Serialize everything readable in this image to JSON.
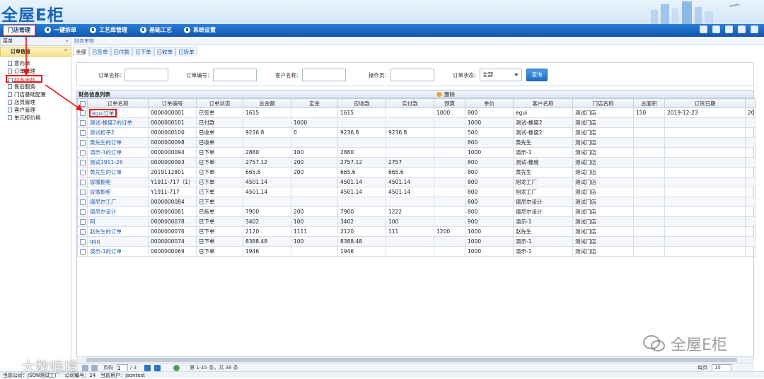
{
  "app": {
    "logo": "全屋E柜"
  },
  "topnav": [
    {
      "label": "门店管理",
      "active": true
    },
    {
      "label": "一键拆单",
      "active": false
    },
    {
      "label": "工艺库管理",
      "active": false
    },
    {
      "label": "基础工艺",
      "active": false
    },
    {
      "label": "系统设置",
      "active": false
    }
  ],
  "sidebar": {
    "header": "菜单",
    "collapse": "«",
    "group": "订单信息",
    "group_arrow": "«",
    "items": [
      "意向单",
      "订单管理",
      "财务审核",
      "售后服务",
      "门店基础配置",
      "店员管理",
      "客户管理",
      "单元柜价格"
    ]
  },
  "breadcrumb": "财务审核",
  "subtabs": [
    "全部",
    "已签单",
    "已付款",
    "已下单",
    "已收单",
    "已拆单"
  ],
  "filter": {
    "order_name_label": "订单名称：",
    "order_no_label": "订单编号：",
    "customer_label": "客户名称：",
    "operator_label": "操作员：",
    "status_label": "订单状态：",
    "status_value": "全部",
    "query_button": "查询"
  },
  "grid": {
    "title": "财务信息列表",
    "delete_label": "删除",
    "columns": [
      "订单名称",
      "订单编号",
      "订单状态",
      "总金额",
      "定金",
      "应收款",
      "实付款",
      "预算",
      "单价",
      "客户名称",
      "门店名称",
      "总面积",
      "订货日期",
      ""
    ],
    "rows": [
      [
        "egui订单",
        "0000000001",
        "已签单",
        "1615",
        "",
        "1615",
        "",
        "1000",
        "800",
        "egui",
        "测试门店",
        "150",
        "2019-12-23",
        "20"
      ],
      [
        "测试-橡度2的订单",
        "0000000101",
        "已付款",
        "",
        "1000",
        "",
        "",
        "",
        "1000",
        "测试-橡度2",
        "测试门店",
        "",
        "",
        ""
      ],
      [
        "测试柜子2",
        "0000000100",
        "已收单",
        "9236.8",
        "0",
        "9236.8",
        "9236.8",
        "",
        "500",
        "测试-橡度2",
        "测试门店",
        "",
        "",
        ""
      ],
      [
        "黄先生的订单",
        "0000000098",
        "已收单",
        "",
        "",
        "",
        "",
        "",
        "800",
        "黄先生",
        "测试门店",
        "",
        "",
        ""
      ],
      [
        "演示-1的订单",
        "0000000094",
        "已下单",
        "2880",
        "100",
        "2880",
        "",
        "",
        "1000",
        "演示-1",
        "测试门店",
        "",
        "",
        ""
      ],
      [
        "测试1911-28",
        "0000000093",
        "已下单",
        "2757.12",
        "200",
        "2757.12",
        "2757",
        "",
        "800",
        "测试-橡度",
        "测试门店",
        "",
        "",
        ""
      ],
      [
        "黄先生的订单",
        "2019112801",
        "已下单",
        "665.6",
        "200",
        "665.6",
        "665.6",
        "",
        "800",
        "黄先生",
        "测试门店",
        "",
        "",
        ""
      ],
      [
        "冒城橱柜",
        "Y1911-717（1）",
        "已下单",
        "4501.14",
        "",
        "4501.14",
        "4501.14",
        "",
        "800",
        "旭龙工厂",
        "测试门店",
        "",
        "",
        ""
      ],
      [
        "冒城橱柜",
        "Y1911-717",
        "已下单",
        "4501.14",
        "",
        "4501.14",
        "4501.14",
        "",
        "800",
        "旭龙工厂",
        "测试门店",
        "",
        "",
        ""
      ],
      [
        "德尼尔工厂",
        "0000000084",
        "已下单",
        "",
        "",
        "",
        "",
        "",
        "800",
        "德尼尔设计",
        "测试门店",
        "",
        "",
        ""
      ],
      [
        "德尼尔设计",
        "0000000081",
        "已拆单",
        "7900",
        "200",
        "7900",
        "1222",
        "",
        "800",
        "德尼尔设计",
        "测试门店",
        "",
        "",
        ""
      ],
      [
        "阿",
        "0000000078",
        "已下单",
        "3402",
        "100",
        "3402",
        "100",
        "",
        "900",
        "演示-1",
        "测试门店",
        "",
        "",
        ""
      ],
      [
        "赵先生的订单",
        "0000000076",
        "已下单",
        "2120",
        "1111",
        "2120",
        "111",
        "1200",
        "1000",
        "赵先生",
        "测试门店",
        "",
        "",
        ""
      ],
      [
        "qqq",
        "0000000074",
        "已下单",
        "8388.48",
        "100",
        "8388.48",
        "",
        "",
        "1000",
        "演示-1",
        "测试门店",
        "",
        "",
        ""
      ],
      [
        "演示-1的订单",
        "0000000069",
        "已下单",
        "1946",
        "",
        "1946",
        "",
        "",
        "1000",
        "演示-1",
        "测试门店",
        "",
        "",
        ""
      ]
    ]
  },
  "pager": {
    "page_label": "页码",
    "page_value": "1",
    "total_pages": "/ 3",
    "summary": "第 1-15 条，共 36 条",
    "per_page_label": "每页",
    "per_page_value": "15"
  },
  "status": "当前公司：JSON测试工厂　公司编号：24　当前用户：jsontest",
  "watermark_left": "大数喵境",
  "watermark_right": "全屋E柜",
  "colors": {
    "nav": "#1a66c0",
    "highlight": "#e11111",
    "link": "#1f5bb0"
  }
}
